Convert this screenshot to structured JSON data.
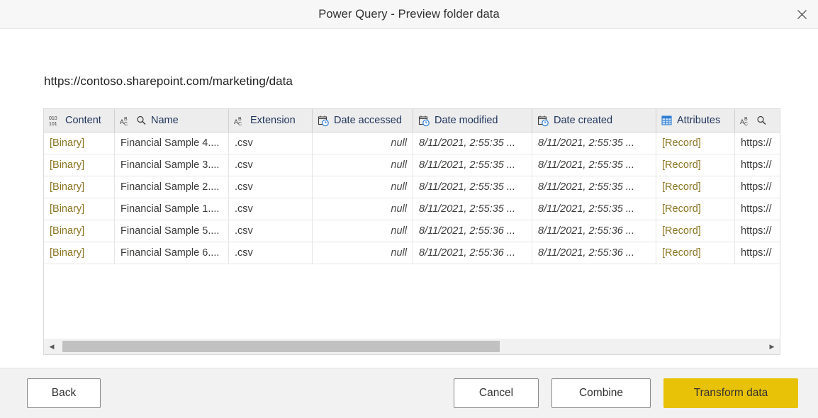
{
  "window": {
    "title": "Power Query - Preview folder data",
    "close_icon": "close-icon"
  },
  "source": {
    "url": "https://contoso.sharepoint.com/marketing/data"
  },
  "colors": {
    "primary_button": "#e8c207",
    "header_text": "#21365c",
    "binary_value": "#8a7420",
    "icon_blue": "#2b7cd3",
    "titlebar": "#f7f7f7",
    "footer": "#f2f2f2"
  },
  "table": {
    "columns": [
      {
        "label": "Content",
        "icon": "binary-icon",
        "type_hint": "binary"
      },
      {
        "label": "Name",
        "icon": "text-any-icon",
        "type_hint": "text"
      },
      {
        "label": "Extension",
        "icon": "text-abc-icon",
        "type_hint": "text"
      },
      {
        "label": "Date accessed",
        "icon": "datetime-icon",
        "type_hint": "datetime"
      },
      {
        "label": "Date modified",
        "icon": "datetime-icon",
        "type_hint": "datetime"
      },
      {
        "label": "Date created",
        "icon": "datetime-icon",
        "type_hint": "datetime"
      },
      {
        "label": "Attributes",
        "icon": "record-table-icon",
        "type_hint": "record"
      },
      {
        "label": "",
        "icon": "text-any-icon",
        "type_hint": "text"
      }
    ],
    "rows": [
      {
        "content": "[Binary]",
        "name": "Financial Sample 4....",
        "extension": ".csv",
        "date_accessed": "null",
        "date_modified": "8/11/2021, 2:55:35 ...",
        "date_created": "8/11/2021, 2:55:35 ...",
        "attributes": "[Record]",
        "folder_path": "https://"
      },
      {
        "content": "[Binary]",
        "name": "Financial Sample 3....",
        "extension": ".csv",
        "date_accessed": "null",
        "date_modified": "8/11/2021, 2:55:35 ...",
        "date_created": "8/11/2021, 2:55:35 ...",
        "attributes": "[Record]",
        "folder_path": "https://"
      },
      {
        "content": "[Binary]",
        "name": "Financial Sample 2....",
        "extension": ".csv",
        "date_accessed": "null",
        "date_modified": "8/11/2021, 2:55:35 ...",
        "date_created": "8/11/2021, 2:55:35 ...",
        "attributes": "[Record]",
        "folder_path": "https://"
      },
      {
        "content": "[Binary]",
        "name": "Financial Sample 1....",
        "extension": ".csv",
        "date_accessed": "null",
        "date_modified": "8/11/2021, 2:55:35 ...",
        "date_created": "8/11/2021, 2:55:35 ...",
        "attributes": "[Record]",
        "folder_path": "https://"
      },
      {
        "content": "[Binary]",
        "name": "Financial Sample 5....",
        "extension": ".csv",
        "date_accessed": "null",
        "date_modified": "8/11/2021, 2:55:36 ...",
        "date_created": "8/11/2021, 2:55:36 ...",
        "attributes": "[Record]",
        "folder_path": "https://"
      },
      {
        "content": "[Binary]",
        "name": "Financial Sample 6....",
        "extension": ".csv",
        "date_accessed": "null",
        "date_modified": "8/11/2021, 2:55:36 ...",
        "date_created": "8/11/2021, 2:55:36 ...",
        "attributes": "[Record]",
        "folder_path": "https://"
      }
    ]
  },
  "scrollbar": {
    "left_arrow": "◀",
    "right_arrow": "▶"
  },
  "footer": {
    "back": "Back",
    "cancel": "Cancel",
    "combine": "Combine",
    "transform": "Transform data"
  }
}
